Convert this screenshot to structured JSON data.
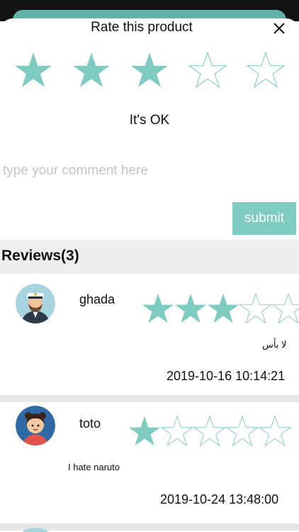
{
  "modal": {
    "title": "Rate this product",
    "close_icon": "close-icon"
  },
  "rating": {
    "value": 3,
    "max": 5,
    "label": "It's OK",
    "star_color": "#7ecbc2"
  },
  "comment": {
    "placeholder": "type your comment here",
    "value": ""
  },
  "submit_label": "submit",
  "reviews": {
    "title": "Reviews(3)",
    "items": [
      {
        "name": "ghada",
        "rating": 3,
        "comment": "لا بأس",
        "date": "2019-10-16 10:14:21",
        "avatar_icon": "sailor-avatar-icon"
      },
      {
        "name": "toto",
        "rating": 1,
        "comment": "I hate naruto",
        "date": "2019-10-24 13:48:00",
        "avatar_icon": "girl-avatar-icon"
      }
    ]
  },
  "colors": {
    "accent": "#7ecbc2",
    "section_bg": "#efefef",
    "header_teal": "#5fb3aa"
  }
}
